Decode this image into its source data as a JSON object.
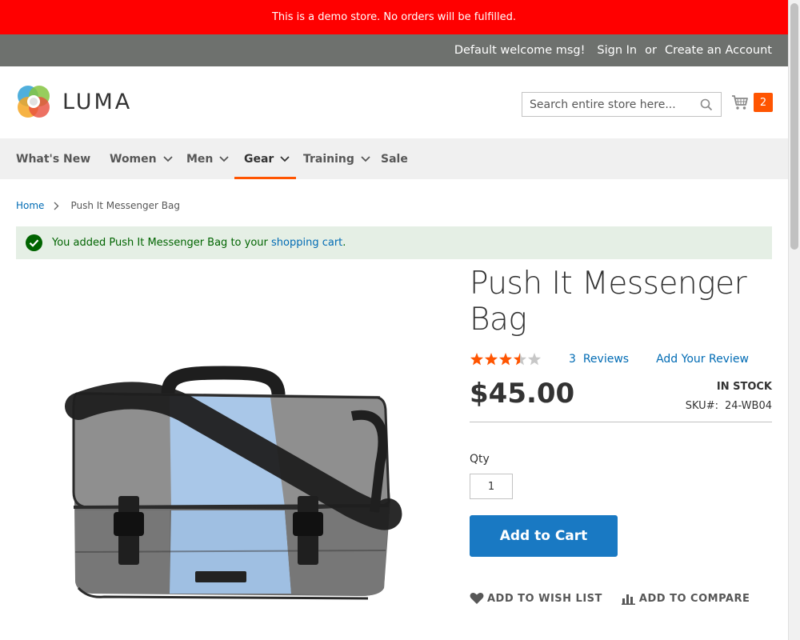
{
  "demo_banner": "This is a demo store. No orders will be fulfilled.",
  "panel": {
    "welcome": "Default welcome msg!",
    "sign_in": "Sign In",
    "or": "or",
    "create_account": "Create an Account"
  },
  "logo": {
    "text": "LUMA"
  },
  "search": {
    "placeholder": "Search entire store here..."
  },
  "minicart": {
    "count": "2"
  },
  "nav": {
    "items": [
      {
        "label": "What's New",
        "has_submenu": false
      },
      {
        "label": "Women",
        "has_submenu": true
      },
      {
        "label": "Men",
        "has_submenu": true
      },
      {
        "label": "Gear",
        "has_submenu": true,
        "active": true
      },
      {
        "label": "Training",
        "has_submenu": true
      },
      {
        "label": "Sale",
        "has_submenu": false
      }
    ]
  },
  "breadcrumb": {
    "home": "Home",
    "current": "Push It Messenger Bag"
  },
  "message": {
    "prefix": "You added Push It Messenger Bag to your ",
    "link": "shopping cart",
    "suffix": "."
  },
  "product": {
    "title_line1": "Push It Messenger",
    "title_line2": "Bag",
    "rating": 3.5,
    "rating_max": 5,
    "reviews_count": "3",
    "reviews_label": "Reviews",
    "add_review": "Add Your Review",
    "price": "$45.00",
    "stock": "In stock",
    "sku_label": "SKU#:",
    "sku": "24-WB04",
    "qty_label": "Qty",
    "qty_value": "1",
    "add_to_cart": "Add to Cart",
    "wishlist": "ADD TO WISH LIST",
    "compare": "ADD TO COMPARE"
  },
  "colors": {
    "banner": "#ff0000",
    "panel": "#6e716e",
    "accent": "#ff5501",
    "link": "#006bb4",
    "button": "#1979c3",
    "success_bg": "#e5efe5",
    "success_text": "#006400"
  }
}
